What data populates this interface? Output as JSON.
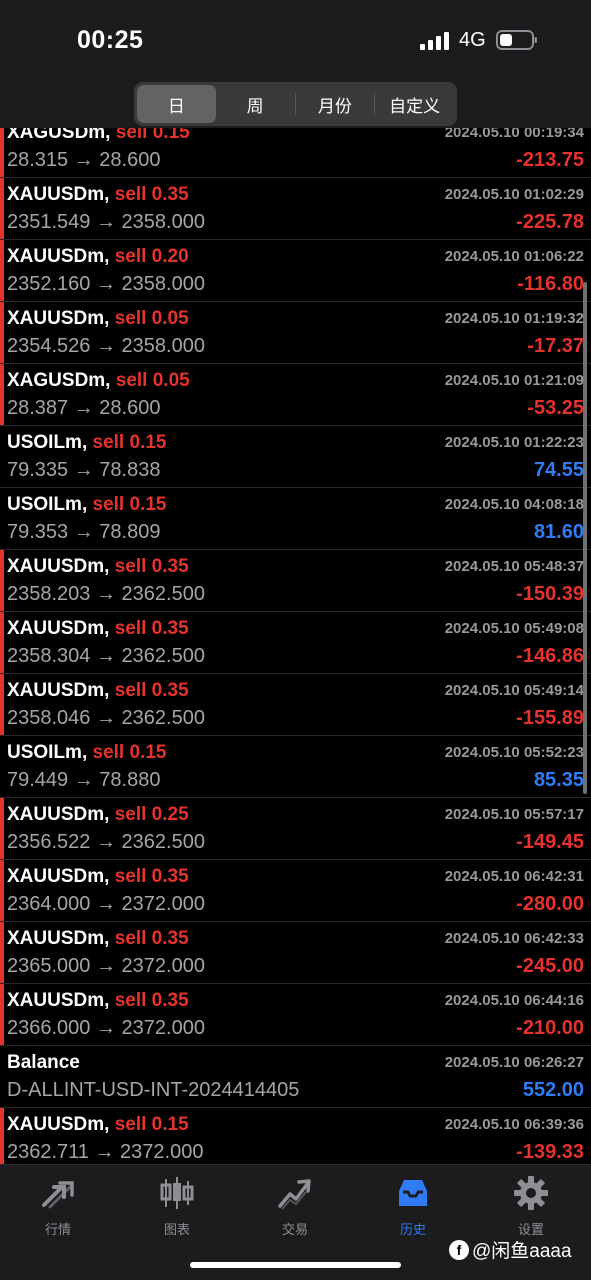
{
  "status": {
    "time": "00:25",
    "network": "4G"
  },
  "segments": [
    {
      "label": "日",
      "active": true
    },
    {
      "label": "周",
      "active": false
    },
    {
      "label": "月份",
      "active": false
    },
    {
      "label": "自定义",
      "active": false
    }
  ],
  "colors": {
    "loss": "#e5322d",
    "profit": "#2f7cf6",
    "accent": "#2f7cf6",
    "background": "#000000"
  },
  "rows": [
    {
      "symbol": "XAGUSDm,",
      "side": "sell 0.15",
      "time": "2024.05.10 00:19:34",
      "prices": "28.315 → 28.600",
      "profit": "-213.75",
      "type": "loss"
    },
    {
      "symbol": "XAUUSDm,",
      "side": "sell 0.35",
      "time": "2024.05.10 01:02:29",
      "prices": "2351.549 → 2358.000",
      "profit": "-225.78",
      "type": "loss"
    },
    {
      "symbol": "XAUUSDm,",
      "side": "sell 0.20",
      "time": "2024.05.10 01:06:22",
      "prices": "2352.160 → 2358.000",
      "profit": "-116.80",
      "type": "loss"
    },
    {
      "symbol": "XAUUSDm,",
      "side": "sell 0.05",
      "time": "2024.05.10 01:19:32",
      "prices": "2354.526 → 2358.000",
      "profit": "-17.37",
      "type": "loss"
    },
    {
      "symbol": "XAGUSDm,",
      "side": "sell 0.05",
      "time": "2024.05.10 01:21:09",
      "prices": "28.387 → 28.600",
      "profit": "-53.25",
      "type": "loss"
    },
    {
      "symbol": "USOILm,",
      "side": "sell 0.15",
      "time": "2024.05.10 01:22:23",
      "prices": "79.335 → 78.838",
      "profit": "74.55",
      "type": "profit"
    },
    {
      "symbol": "USOILm,",
      "side": "sell 0.15",
      "time": "2024.05.10 04:08:18",
      "prices": "79.353 → 78.809",
      "profit": "81.60",
      "type": "profit"
    },
    {
      "symbol": "XAUUSDm,",
      "side": "sell 0.35",
      "time": "2024.05.10 05:48:37",
      "prices": "2358.203 → 2362.500",
      "profit": "-150.39",
      "type": "loss"
    },
    {
      "symbol": "XAUUSDm,",
      "side": "sell 0.35",
      "time": "2024.05.10 05:49:08",
      "prices": "2358.304 → 2362.500",
      "profit": "-146.86",
      "type": "loss"
    },
    {
      "symbol": "XAUUSDm,",
      "side": "sell 0.35",
      "time": "2024.05.10 05:49:14",
      "prices": "2358.046 → 2362.500",
      "profit": "-155.89",
      "type": "loss"
    },
    {
      "symbol": "USOILm,",
      "side": "sell 0.15",
      "time": "2024.05.10 05:52:23",
      "prices": "79.449 → 78.880",
      "profit": "85.35",
      "type": "profit"
    },
    {
      "symbol": "XAUUSDm,",
      "side": "sell 0.25",
      "time": "2024.05.10 05:57:17",
      "prices": "2356.522 → 2362.500",
      "profit": "-149.45",
      "type": "loss"
    },
    {
      "symbol": "XAUUSDm,",
      "side": "sell 0.35",
      "time": "2024.05.10 06:42:31",
      "prices": "2364.000 → 2372.000",
      "profit": "-280.00",
      "type": "loss"
    },
    {
      "symbol": "XAUUSDm,",
      "side": "sell 0.35",
      "time": "2024.05.10 06:42:33",
      "prices": "2365.000 → 2372.000",
      "profit": "-245.00",
      "type": "loss"
    },
    {
      "symbol": "XAUUSDm,",
      "side": "sell 0.35",
      "time": "2024.05.10 06:44:16",
      "prices": "2366.000 → 2372.000",
      "profit": "-210.00",
      "type": "loss"
    },
    {
      "symbol": "Balance",
      "side": "",
      "time": "2024.05.10 06:26:27",
      "prices": "D-ALLINT-USD-INT-2024414405",
      "profit": "552.00",
      "type": "profit"
    },
    {
      "symbol": "XAUUSDm,",
      "side": "sell 0.15",
      "time": "2024.05.10 06:39:36",
      "prices": "2362.711 → 2372.000",
      "profit": "-139.33",
      "type": "loss"
    }
  ],
  "tabs": [
    {
      "label": "行情",
      "icon": "quotes-arrow-icon",
      "active": false
    },
    {
      "label": "图表",
      "icon": "candlestick-chart-icon",
      "active": false
    },
    {
      "label": "交易",
      "icon": "trade-trend-icon",
      "active": false
    },
    {
      "label": "历史",
      "icon": "history-inbox-icon",
      "active": true
    },
    {
      "label": "设置",
      "icon": "gear-icon",
      "active": false
    }
  ],
  "watermark": {
    "text": "@闲鱼aaaa"
  }
}
